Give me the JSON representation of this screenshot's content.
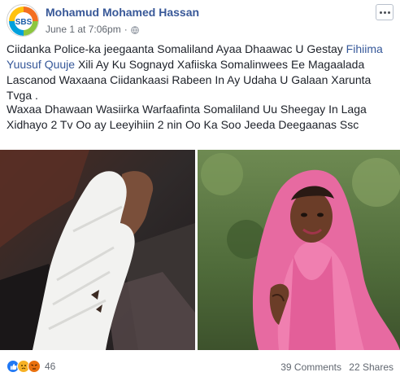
{
  "post": {
    "author": "Mohamud Mohamed Hassan",
    "avatar_text": "SBS",
    "timestamp": "June 1 at 7:06pm",
    "separator": "·",
    "privacy_icon": "globe-icon",
    "more_icon": "ellipsis-icon",
    "paragraph1": {
      "before": "Ciidanka Police-ka jeegaanta Somaliland Ayaa Dhaawac U Gestay ",
      "link": "Fihiima Yuusuf Quuje",
      "after": " Xili Ay Ku Sognayd Xafiiska Somalinwees Ee Magaalada Lascanod Waxaana Ciidankaasi Rabeen In Ay Udaha U Galaan Xarunta Tvga ."
    },
    "paragraph2": "Waxaa Dhawaan Wasiirka Warfaafinta Somaliland Uu Sheegay In Laga Xidhayo 2 Tv Oo ay Leeyihiin 2 nin Oo Ka Soo Jeeda Deegaanas Ssc",
    "images": [
      {
        "description_icon": "bandaged-hand-photo"
      },
      {
        "description_icon": "woman-pink-headscarf-photo"
      }
    ],
    "reactions": {
      "icons": [
        "like-icon",
        "sad-icon",
        "angry-icon"
      ],
      "count": "46"
    },
    "comments": "39 Comments",
    "shares": "22 Shares"
  },
  "colors": {
    "link": "#365899",
    "author": "#385898",
    "meta": "#616770"
  }
}
